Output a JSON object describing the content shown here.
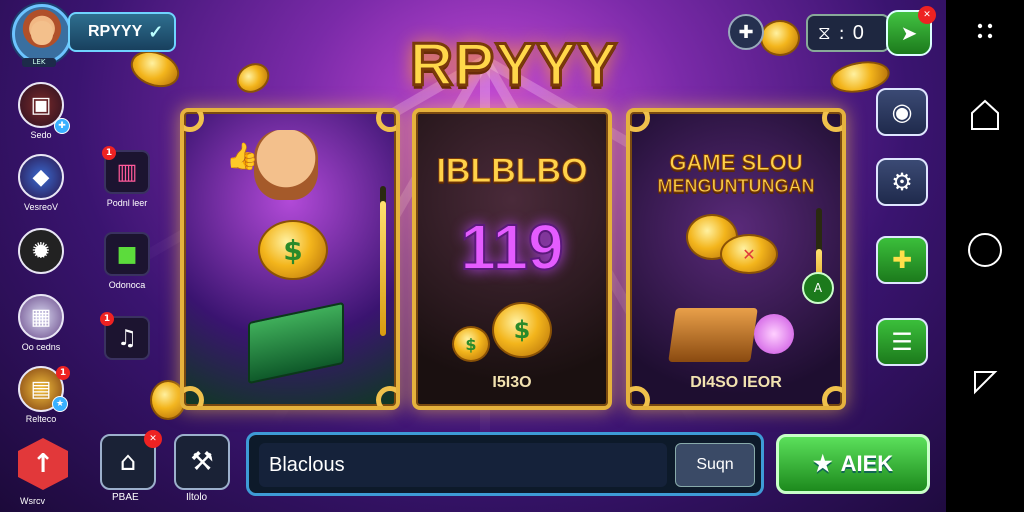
{
  "header": {
    "player_name": "RPYYY",
    "profile_tag": "LEK",
    "logo": "RPYYY",
    "counter_value": "0"
  },
  "sidebar": {
    "items": [
      {
        "label": "Sedo",
        "icon": "treasure-chest-icon"
      },
      {
        "label": "VesreoV",
        "icon": "gem-bag-icon"
      },
      {
        "label": "",
        "icon": "film-reel-icon"
      },
      {
        "label": "Oo cedns",
        "icon": "gift-box-icon"
      },
      {
        "label": "Relteco",
        "icon": "gold-pile-icon"
      },
      {
        "label": "Wsrcv",
        "icon": "alert-icon"
      }
    ],
    "squares": [
      {
        "label": "Podnl leer",
        "badge": "1",
        "icon": "slot-icon"
      },
      {
        "label": "Odonoca",
        "badge": "",
        "icon": "green-dice-icon"
      },
      {
        "label": "",
        "badge": "1",
        "icon": "music-note-icon"
      }
    ]
  },
  "cards": [
    {
      "title": "",
      "value": "",
      "gauge_level": 0.9
    },
    {
      "title": "IBLBLBO",
      "big_number": "119",
      "value": "I5I3O"
    },
    {
      "title_line1": "GAME SLOU",
      "title_line2": "MENGUNTUNGAN",
      "value": "DI4SO IEOR",
      "gauge_level": 0.55,
      "gauge_badge": "A"
    }
  ],
  "bottom": {
    "btn1_label": "PBAE",
    "btn2_label": "Iltolo",
    "input_value": "Blaclous",
    "submit_label": "Suqn",
    "cta_label": "AIEK"
  },
  "colors": {
    "accent_gold": "#ffd84a",
    "cta_green": "#2fb52f",
    "input_border": "#3e9bd6"
  }
}
